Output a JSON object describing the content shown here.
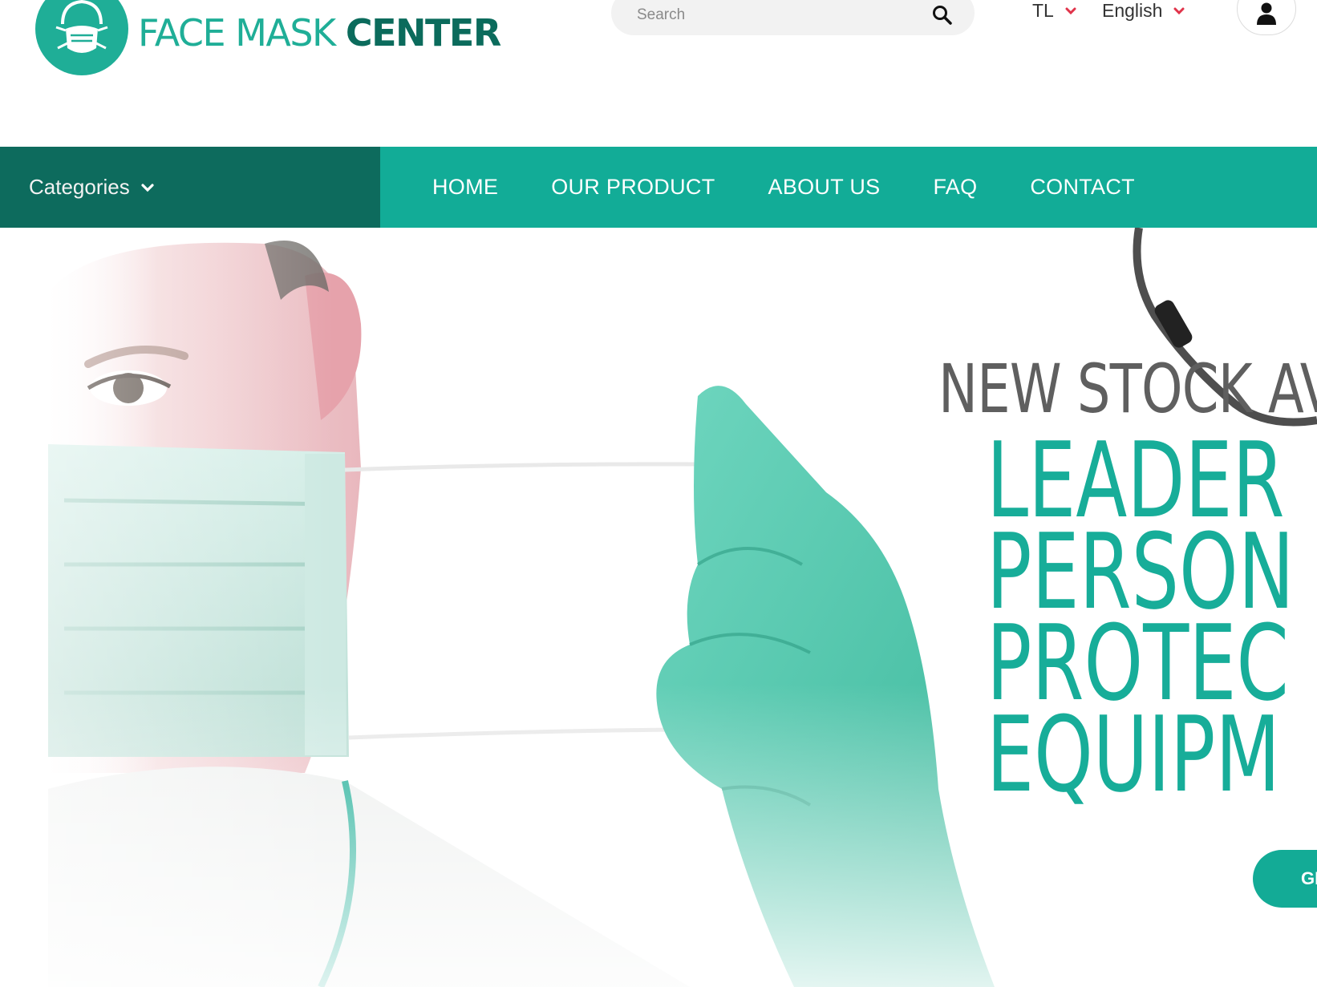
{
  "brand": {
    "name_light": "FACE MASK ",
    "name_bold": "CENTER",
    "logo_icon": "face-mask-icon",
    "colors": {
      "primary": "#12ac97",
      "dark": "#0d6b5d",
      "accent_red": "#e0334a"
    }
  },
  "header": {
    "search": {
      "placeholder": "Search",
      "value": "",
      "icon": "search-icon"
    },
    "currency": {
      "selected": "TL",
      "icon": "chevron-down-icon"
    },
    "language": {
      "selected": "English",
      "icon": "chevron-down-icon"
    },
    "account": {
      "icon": "user-icon"
    }
  },
  "nav": {
    "categories_label": "Categories",
    "items": [
      {
        "label": "HOME"
      },
      {
        "label": "OUR PRODUCT"
      },
      {
        "label": "ABOUT US"
      },
      {
        "label": "FAQ"
      },
      {
        "label": "CONTACT"
      }
    ]
  },
  "hero": {
    "kicker": "NEW STOCK AV",
    "headline_lines": [
      "LEADER",
      "PERSON",
      "PROTEC",
      "EQUIPM"
    ],
    "cta_label": "GE"
  }
}
